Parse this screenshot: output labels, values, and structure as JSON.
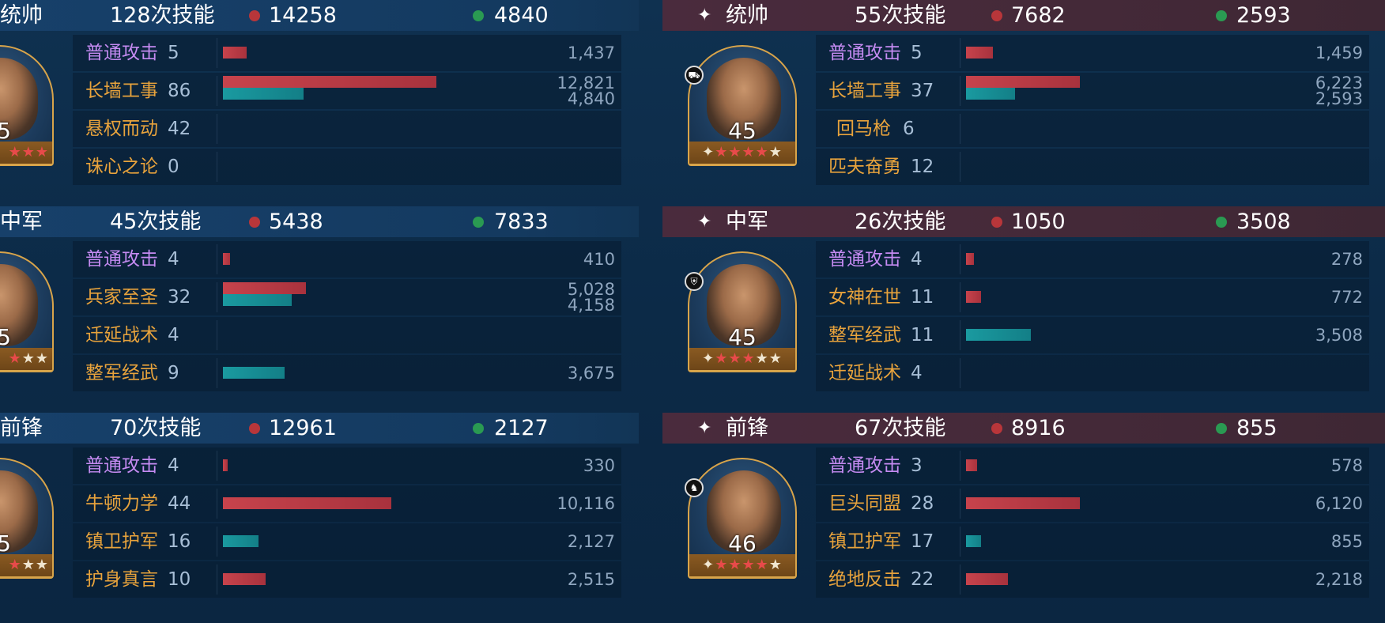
{
  "left": {
    "sections": [
      {
        "role": "统帅",
        "skills_label": "128次技能",
        "damage_total": "14258",
        "heal_total": "4840",
        "level": "5",
        "stars_red": "★★★",
        "stars_white": "",
        "rows": [
          {
            "name": "普通攻击",
            "basic": true,
            "count": "5",
            "dmg_frac": 0.1,
            "heal_frac": 0,
            "dmg": "1,437",
            "heal": ""
          },
          {
            "name": "长墙工事",
            "basic": false,
            "count": "86",
            "dmg_frac": 0.9,
            "heal_frac": 0.34,
            "dmg": "12,821",
            "heal": "4,840"
          },
          {
            "name": "悬权而动",
            "basic": false,
            "count": "42",
            "dmg_frac": 0,
            "heal_frac": 0,
            "dmg": "",
            "heal": ""
          },
          {
            "name": "诛心之论",
            "basic": false,
            "count": "0",
            "dmg_frac": 0,
            "heal_frac": 0,
            "dmg": "",
            "heal": ""
          }
        ]
      },
      {
        "role": "中军",
        "skills_label": "45次技能",
        "damage_total": "5438",
        "heal_total": "7833",
        "level": "5",
        "stars_red": "★",
        "stars_white": "★★",
        "rows": [
          {
            "name": "普通攻击",
            "basic": true,
            "count": "4",
            "dmg_frac": 0.03,
            "heal_frac": 0,
            "dmg": "410",
            "heal": ""
          },
          {
            "name": "兵家至圣",
            "basic": false,
            "count": "32",
            "dmg_frac": 0.35,
            "heal_frac": 0.29,
            "dmg": "5,028",
            "heal": "4,158"
          },
          {
            "name": "迁延战术",
            "basic": false,
            "count": "4",
            "dmg_frac": 0,
            "heal_frac": 0,
            "dmg": "",
            "heal": ""
          },
          {
            "name": "整军经武",
            "basic": false,
            "count": "9",
            "dmg_frac": 0,
            "heal_frac": 0.26,
            "dmg": "",
            "heal": "3,675"
          }
        ]
      },
      {
        "role": "前锋",
        "skills_label": "70次技能",
        "damage_total": "12961",
        "heal_total": "2127",
        "level": "5",
        "stars_red": "★",
        "stars_white": "★★",
        "rows": [
          {
            "name": "普通攻击",
            "basic": true,
            "count": "4",
            "dmg_frac": 0.02,
            "heal_frac": 0,
            "dmg": "330",
            "heal": ""
          },
          {
            "name": "牛顿力学",
            "basic": false,
            "count": "44",
            "dmg_frac": 0.71,
            "heal_frac": 0,
            "dmg": "10,116",
            "heal": ""
          },
          {
            "name": "镇卫护军",
            "basic": false,
            "count": "16",
            "dmg_frac": 0,
            "heal_frac": 0.15,
            "dmg": "",
            "heal": "2,127"
          },
          {
            "name": "护身真言",
            "basic": false,
            "count": "10",
            "dmg_frac": 0.18,
            "heal_frac": 0,
            "dmg": "2,515",
            "heal": ""
          }
        ]
      }
    ]
  },
  "right": {
    "sections": [
      {
        "role": "统帅",
        "skills_label": "55次技能",
        "damage_total": "7682",
        "heal_total": "2593",
        "level": "45",
        "badge_icon": "chariot-icon",
        "stars_red": "★★★★",
        "stars_white": "★",
        "rows": [
          {
            "name": "普通攻击",
            "basic": true,
            "count": "5",
            "dmg_frac": 0.07,
            "heal_frac": 0,
            "dmg": "1,459",
            "heal": ""
          },
          {
            "name": "长墙工事",
            "basic": false,
            "count": "37",
            "dmg_frac": 0.3,
            "heal_frac": 0.13,
            "dmg": "6,223",
            "heal": "2,593"
          },
          {
            "name": "回马枪",
            "basic": false,
            "count": "6",
            "dmg_frac": 0,
            "heal_frac": 0,
            "dmg": "",
            "heal": ""
          },
          {
            "name": "匹夫奋勇",
            "basic": false,
            "count": "12",
            "dmg_frac": 0,
            "heal_frac": 0,
            "dmg": "",
            "heal": ""
          }
        ]
      },
      {
        "role": "中军",
        "skills_label": "26次技能",
        "damage_total": "1050",
        "heal_total": "3508",
        "level": "45",
        "badge_icon": "shield-icon",
        "stars_red": "★★★",
        "stars_white": "★★",
        "rows": [
          {
            "name": "普通攻击",
            "basic": true,
            "count": "4",
            "dmg_frac": 0.02,
            "heal_frac": 0,
            "dmg": "278",
            "heal": ""
          },
          {
            "name": "女神在世",
            "basic": false,
            "count": "11",
            "dmg_frac": 0.04,
            "heal_frac": 0,
            "dmg": "772",
            "heal": ""
          },
          {
            "name": "整军经武",
            "basic": false,
            "count": "11",
            "dmg_frac": 0,
            "heal_frac": 0.17,
            "dmg": "",
            "heal": "3,508"
          },
          {
            "name": "迁延战术",
            "basic": false,
            "count": "4",
            "dmg_frac": 0,
            "heal_frac": 0,
            "dmg": "",
            "heal": ""
          }
        ]
      },
      {
        "role": "前锋",
        "skills_label": "67次技能",
        "damage_total": "8916",
        "heal_total": "855",
        "level": "46",
        "badge_icon": "horse-icon",
        "stars_red": "★★★★",
        "stars_white": "★",
        "rows": [
          {
            "name": "普通攻击",
            "basic": true,
            "count": "3",
            "dmg_frac": 0.03,
            "heal_frac": 0,
            "dmg": "578",
            "heal": ""
          },
          {
            "name": "巨头同盟",
            "basic": false,
            "count": "28",
            "dmg_frac": 0.3,
            "heal_frac": 0,
            "dmg": "6,120",
            "heal": ""
          },
          {
            "name": "镇卫护军",
            "basic": false,
            "count": "17",
            "dmg_frac": 0,
            "heal_frac": 0.04,
            "dmg": "",
            "heal": "855"
          },
          {
            "name": "绝地反击",
            "basic": false,
            "count": "22",
            "dmg_frac": 0.11,
            "heal_frac": 0,
            "dmg": "2,218",
            "heal": ""
          }
        ]
      }
    ]
  },
  "colors": {
    "damage": "#b8363a",
    "heal": "#2a9a52",
    "basic_skill": "#c58bf2",
    "skill": "#e8a33c"
  }
}
